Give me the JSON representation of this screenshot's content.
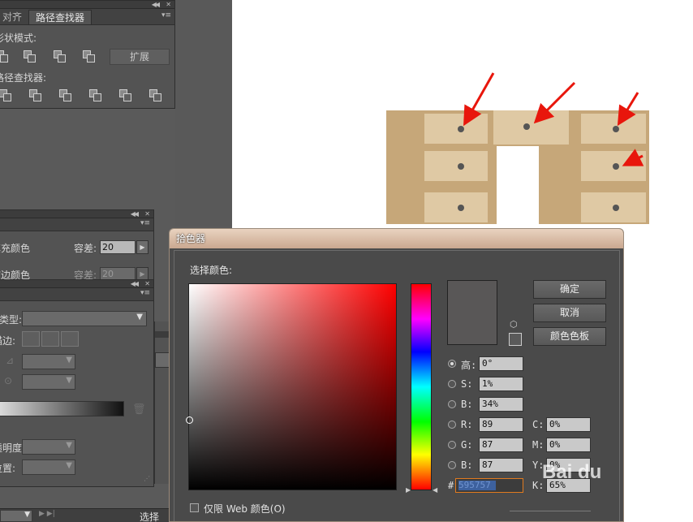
{
  "pathfinder_panel": {
    "tabs": [
      "对齐",
      "路径查找器"
    ],
    "shape_modes_label": "形状模式:",
    "expand_button": "扩展",
    "pathfinders_label": "路径查找器:"
  },
  "magic_wand_panel": {
    "fill_color_label": "填充颜色",
    "tolerance_label": "容差:",
    "tolerance_value": "20",
    "stroke_color_label": "描边颜色",
    "tolerance2_label": "容差:",
    "tolerance2_value": "20"
  },
  "gradient_panel": {
    "type_label": "类型:",
    "stroke_label": "描边:",
    "opacity_label": "不透明度:",
    "location_label": "位置:"
  },
  "status_bar": {
    "tool_label": "选择"
  },
  "color_picker": {
    "title": "拾色器",
    "select_color_label": "选择颜色:",
    "ok_button": "确定",
    "cancel_button": "取消",
    "swatches_button": "颜色色板",
    "h_label": "高:",
    "h_value": "0°",
    "s_label": "S:",
    "s_value": "1%",
    "b_label": "B:",
    "b_value": "34%",
    "r_label": "R:",
    "r_value": "89",
    "g_label": "G:",
    "g_value": "87",
    "bl_label": "B:",
    "bl_value": "87",
    "c_label": "C:",
    "c_value": "0%",
    "m_label": "M:",
    "m_value": "0%",
    "y_label": "Y:",
    "y_value": "0%",
    "k_label": "K:",
    "k_value": "65%",
    "hex_label": "#",
    "hex_value": "595757",
    "web_only_label": "仅限 Web 颜色(O)",
    "current_color": "#595757"
  },
  "watermark": "Bai du"
}
